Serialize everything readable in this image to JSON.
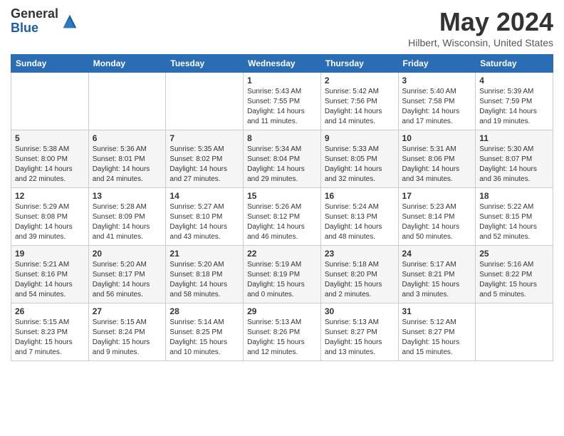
{
  "logo": {
    "general": "General",
    "blue": "Blue"
  },
  "title": "May 2024",
  "location": "Hilbert, Wisconsin, United States",
  "days_of_week": [
    "Sunday",
    "Monday",
    "Tuesday",
    "Wednesday",
    "Thursday",
    "Friday",
    "Saturday"
  ],
  "weeks": [
    [
      {
        "num": "",
        "info": ""
      },
      {
        "num": "",
        "info": ""
      },
      {
        "num": "",
        "info": ""
      },
      {
        "num": "1",
        "info": "Sunrise: 5:43 AM\nSunset: 7:55 PM\nDaylight: 14 hours\nand 11 minutes."
      },
      {
        "num": "2",
        "info": "Sunrise: 5:42 AM\nSunset: 7:56 PM\nDaylight: 14 hours\nand 14 minutes."
      },
      {
        "num": "3",
        "info": "Sunrise: 5:40 AM\nSunset: 7:58 PM\nDaylight: 14 hours\nand 17 minutes."
      },
      {
        "num": "4",
        "info": "Sunrise: 5:39 AM\nSunset: 7:59 PM\nDaylight: 14 hours\nand 19 minutes."
      }
    ],
    [
      {
        "num": "5",
        "info": "Sunrise: 5:38 AM\nSunset: 8:00 PM\nDaylight: 14 hours\nand 22 minutes."
      },
      {
        "num": "6",
        "info": "Sunrise: 5:36 AM\nSunset: 8:01 PM\nDaylight: 14 hours\nand 24 minutes."
      },
      {
        "num": "7",
        "info": "Sunrise: 5:35 AM\nSunset: 8:02 PM\nDaylight: 14 hours\nand 27 minutes."
      },
      {
        "num": "8",
        "info": "Sunrise: 5:34 AM\nSunset: 8:04 PM\nDaylight: 14 hours\nand 29 minutes."
      },
      {
        "num": "9",
        "info": "Sunrise: 5:33 AM\nSunset: 8:05 PM\nDaylight: 14 hours\nand 32 minutes."
      },
      {
        "num": "10",
        "info": "Sunrise: 5:31 AM\nSunset: 8:06 PM\nDaylight: 14 hours\nand 34 minutes."
      },
      {
        "num": "11",
        "info": "Sunrise: 5:30 AM\nSunset: 8:07 PM\nDaylight: 14 hours\nand 36 minutes."
      }
    ],
    [
      {
        "num": "12",
        "info": "Sunrise: 5:29 AM\nSunset: 8:08 PM\nDaylight: 14 hours\nand 39 minutes."
      },
      {
        "num": "13",
        "info": "Sunrise: 5:28 AM\nSunset: 8:09 PM\nDaylight: 14 hours\nand 41 minutes."
      },
      {
        "num": "14",
        "info": "Sunrise: 5:27 AM\nSunset: 8:10 PM\nDaylight: 14 hours\nand 43 minutes."
      },
      {
        "num": "15",
        "info": "Sunrise: 5:26 AM\nSunset: 8:12 PM\nDaylight: 14 hours\nand 46 minutes."
      },
      {
        "num": "16",
        "info": "Sunrise: 5:24 AM\nSunset: 8:13 PM\nDaylight: 14 hours\nand 48 minutes."
      },
      {
        "num": "17",
        "info": "Sunrise: 5:23 AM\nSunset: 8:14 PM\nDaylight: 14 hours\nand 50 minutes."
      },
      {
        "num": "18",
        "info": "Sunrise: 5:22 AM\nSunset: 8:15 PM\nDaylight: 14 hours\nand 52 minutes."
      }
    ],
    [
      {
        "num": "19",
        "info": "Sunrise: 5:21 AM\nSunset: 8:16 PM\nDaylight: 14 hours\nand 54 minutes."
      },
      {
        "num": "20",
        "info": "Sunrise: 5:20 AM\nSunset: 8:17 PM\nDaylight: 14 hours\nand 56 minutes."
      },
      {
        "num": "21",
        "info": "Sunrise: 5:20 AM\nSunset: 8:18 PM\nDaylight: 14 hours\nand 58 minutes."
      },
      {
        "num": "22",
        "info": "Sunrise: 5:19 AM\nSunset: 8:19 PM\nDaylight: 15 hours\nand 0 minutes."
      },
      {
        "num": "23",
        "info": "Sunrise: 5:18 AM\nSunset: 8:20 PM\nDaylight: 15 hours\nand 2 minutes."
      },
      {
        "num": "24",
        "info": "Sunrise: 5:17 AM\nSunset: 8:21 PM\nDaylight: 15 hours\nand 3 minutes."
      },
      {
        "num": "25",
        "info": "Sunrise: 5:16 AM\nSunset: 8:22 PM\nDaylight: 15 hours\nand 5 minutes."
      }
    ],
    [
      {
        "num": "26",
        "info": "Sunrise: 5:15 AM\nSunset: 8:23 PM\nDaylight: 15 hours\nand 7 minutes."
      },
      {
        "num": "27",
        "info": "Sunrise: 5:15 AM\nSunset: 8:24 PM\nDaylight: 15 hours\nand 9 minutes."
      },
      {
        "num": "28",
        "info": "Sunrise: 5:14 AM\nSunset: 8:25 PM\nDaylight: 15 hours\nand 10 minutes."
      },
      {
        "num": "29",
        "info": "Sunrise: 5:13 AM\nSunset: 8:26 PM\nDaylight: 15 hours\nand 12 minutes."
      },
      {
        "num": "30",
        "info": "Sunrise: 5:13 AM\nSunset: 8:27 PM\nDaylight: 15 hours\nand 13 minutes."
      },
      {
        "num": "31",
        "info": "Sunrise: 5:12 AM\nSunset: 8:27 PM\nDaylight: 15 hours\nand 15 minutes."
      },
      {
        "num": "",
        "info": ""
      }
    ]
  ]
}
